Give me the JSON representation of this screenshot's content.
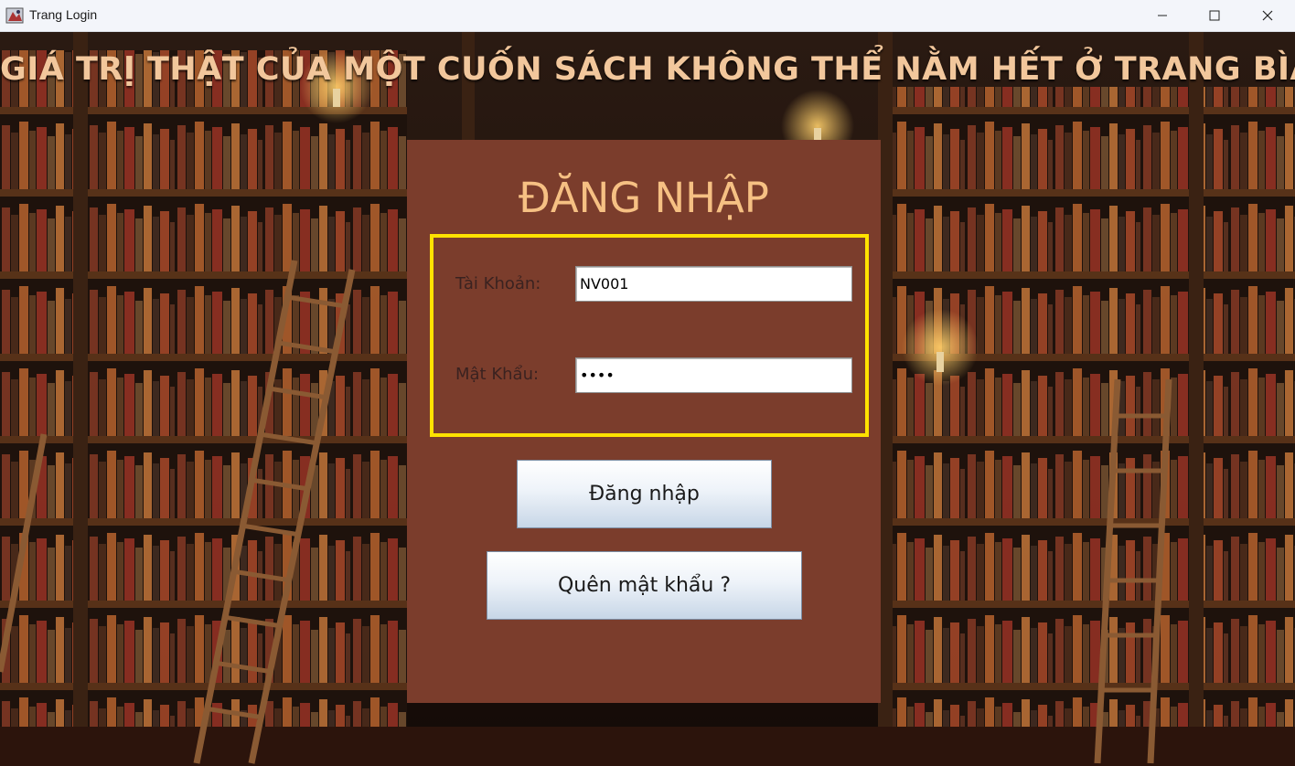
{
  "window": {
    "title": "Trang Login",
    "icon": "java-app-icon",
    "controls": [
      "minimize-icon",
      "maximize-icon",
      "close-icon"
    ]
  },
  "headline": "GIÁ TRỊ THẬT CỦA MỘT CUỐN SÁCH KHÔNG THỂ NẰM HẾT Ở TRANG BÌA",
  "login": {
    "title": "ĐĂNG NHẬP",
    "account_label": "Tài Khoản:",
    "account_value": "NV001",
    "password_label": "Mật Khẩu:",
    "password_value": "1234",
    "login_button": "Đăng nhập",
    "forgot_button": "Quên mật khẩu ?"
  },
  "colors": {
    "panel": "#7b3d2c",
    "headline": "#f2c79c",
    "panel_title": "#f6c083",
    "field_border": "#ffe200"
  }
}
